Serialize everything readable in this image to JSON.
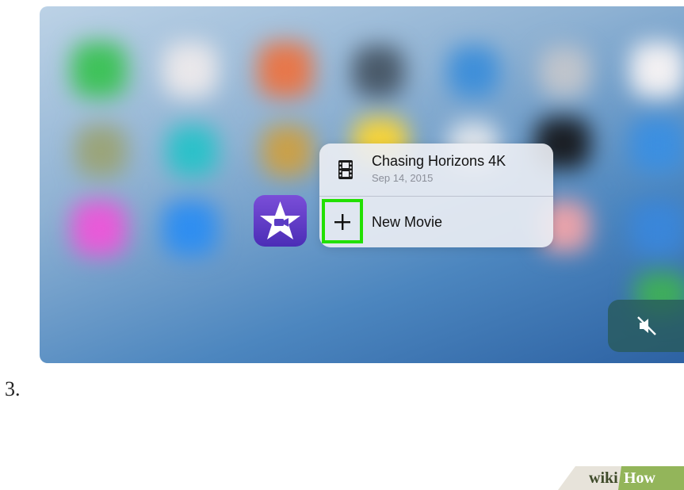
{
  "menu": {
    "movie_title": "Chasing Horizons 4K",
    "movie_date": "Sep 14, 2015",
    "new_movie_label": "New Movie",
    "film_icon": "film-strip-icon",
    "plus_icon": "plus-icon",
    "highlight_color": "#22e000"
  },
  "app_icon": {
    "icon": "imovie-star-camera-icon",
    "background": "#5b3cc4"
  },
  "mute_button": {
    "icon": "speaker-muted-icon"
  },
  "step": {
    "number": "3."
  },
  "watermark": {
    "part1": "wiki",
    "part2": "How"
  }
}
